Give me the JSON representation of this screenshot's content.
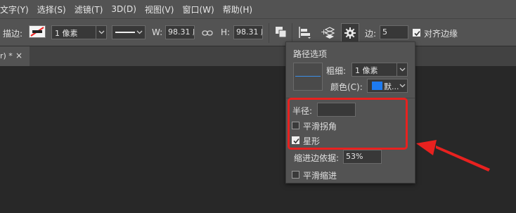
{
  "menubar": {
    "items": [
      "文字(Y)",
      "选择(S)",
      "滤镜(T)",
      "3D(D)",
      "视图(V)",
      "窗口(W)",
      "帮助(H)"
    ]
  },
  "options": {
    "stroke_label": "描边:",
    "stroke_width": "1 像素",
    "w_label": "W:",
    "w_value": "98.31 废",
    "h_label": "H:",
    "h_value": "98.31 废",
    "sides_label": "边:",
    "sides_value": "5",
    "align_edges_label": "对齐边缘",
    "align_edges_checked": true
  },
  "tab": {
    "title": "r) *",
    "close": "×"
  },
  "popup": {
    "title": "路径选项",
    "thickness_label": "粗细:",
    "thickness_value": "1 像素",
    "color_label": "颜色(C):",
    "color_value": "默...",
    "color_swatch": "#1e7bf0",
    "radius_label": "半径:",
    "radius_value": "",
    "smooth_corners_label": "平滑拐角",
    "smooth_corners_checked": false,
    "star_label": "星形",
    "star_checked": true,
    "indent_label": "缩进边依据:",
    "indent_value": "53%",
    "smooth_indents_label": "平滑缩进",
    "smooth_indents_checked": false
  },
  "colors": {
    "highlight_red": "#e8211f",
    "path_line_blue": "#3c8ee8"
  }
}
